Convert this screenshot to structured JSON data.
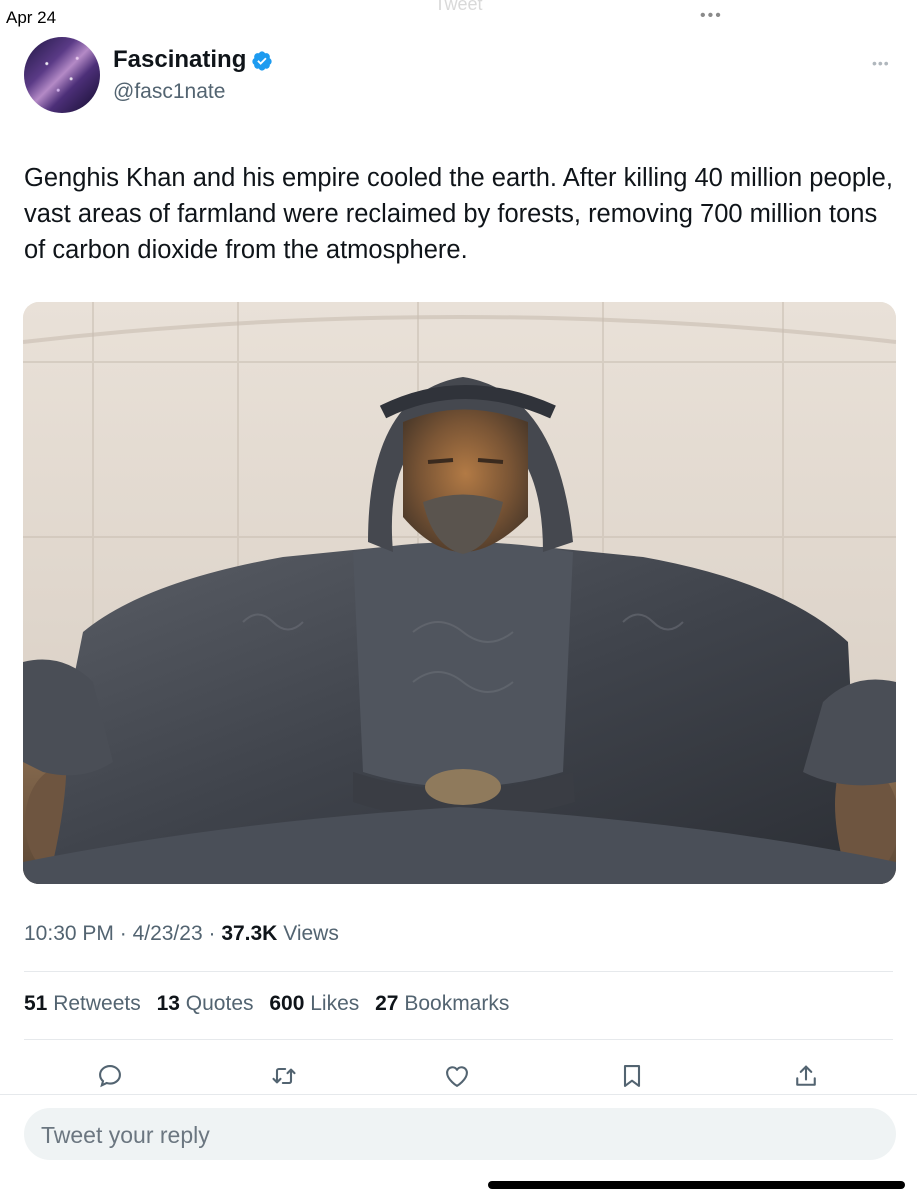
{
  "status": {
    "date": "Apr 24",
    "title": "Tweet"
  },
  "author": {
    "name": "Fascinating",
    "handle": "@fasc1nate"
  },
  "tweet": {
    "text": "Genghis Khan and his empire cooled the earth.  After killing 40 million people, vast areas of farmland were reclaimed by forests, removing 700 million tons of carbon dioxide from the atmosphere.",
    "time": "10:30 PM",
    "date": "4/23/23",
    "views_count": "37.3K",
    "views_label": "Views"
  },
  "stats": {
    "retweets_count": "51",
    "retweets_label": "Retweets",
    "quotes_count": "13",
    "quotes_label": "Quotes",
    "likes_count": "600",
    "likes_label": "Likes",
    "bookmarks_count": "27",
    "bookmarks_label": "Bookmarks"
  },
  "reply": {
    "placeholder": "Tweet your reply"
  },
  "colors": {
    "accent": "#1d9bf0",
    "secondary_text": "#536471",
    "primary_text": "#0f1419"
  },
  "icons": {
    "verified": "verified-badge-icon",
    "reply": "reply-icon",
    "retweet": "retweet-icon",
    "like": "heart-icon",
    "bookmark": "bookmark-icon",
    "share": "share-icon"
  }
}
